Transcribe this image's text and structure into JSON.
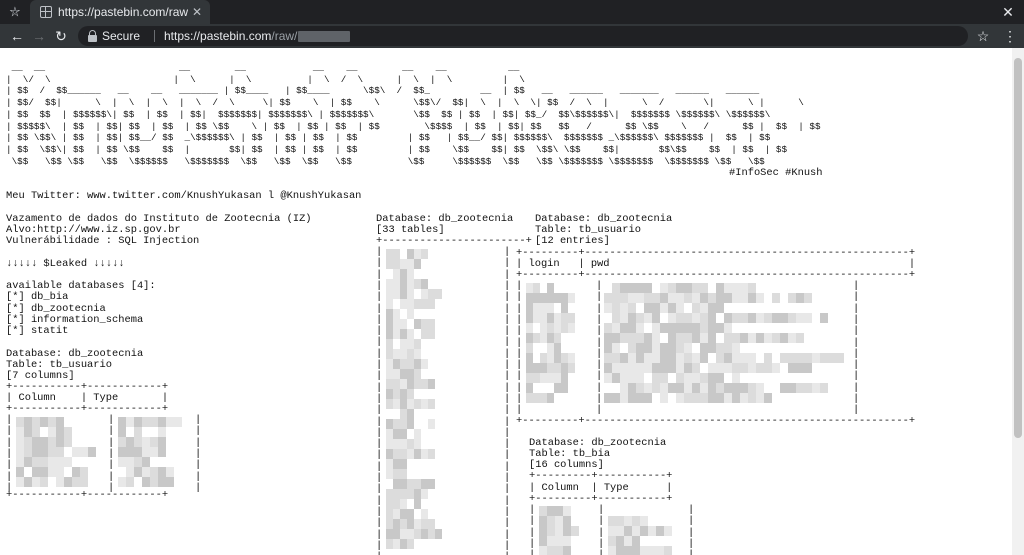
{
  "browser": {
    "tab_title": "https://pastebin.com/raw/",
    "security_label": "Secure",
    "url_domain": "https://pastebin.com",
    "url_path": "/raw/"
  },
  "paste": {
    "banner": [
      " __  __                        __        __            __    __        __    __           __                                      ",
      "|  \\/  \\                      |  \\      |  \\          |  \\  /  \\      |  \\  |  \\         |  \\                                     ",
      "| $$  /  $$______   __    __   _______ | $$____   | $$____      \\$$\\  /  $$_         __  | $$   __   ______   _______   ______   ______  ",
      "| $$/  $$|      \\  |  \\  |  \\  |  \\  /  \\     \\| $$    \\  | $$    \\      \\$$\\/  $$|  \\  |  \\  \\| $$  /  \\  |      \\  /       \\|      \\ |      \\ ",
      "| $$  $$  | $$$$$$\\| $$  | $$  | $$|  $$$$$$$| $$$$$$$\\ | $$$$$$$\\       \\$$  $$ | $$  | $$| $$_/  $$\\$$$$$$\\|  $$$$$$$ \\$$$$$$\\ \\$$$$$$\\",
      "| $$$$$\\  | $$  | $$| $$  | $$  | $$ \\$$    \\ | $$  | $$ | $$  | $$        \\$$$$  | $$  | $$| $$   $$   /      $$ \\$$    \\   /      $$ |  $$  | $$",
      "| $$ \\$$\\ | $$  | $$| $$__/ $$  _\\$$$$$$\\ | $$  | $$ | $$  | $$         | $$   | $$__/ $$| $$$$$$\\  $$$$$$$ _\\$$$$$$\\ $$$$$$$ |  $$  | $$",
      "| $$  \\$$\\| $$  | $$ \\$$    $$  |       $$| $$  | $$ | $$  | $$         | $$    \\$$    $$| $$  \\$$\\ \\$$    $$|       $$\\$$    $$  | $$  | $$",
      " \\$$   \\$$ \\$$   \\$$  \\$$$$$$   \\$$$$$$$  \\$$   \\$$  \\$$   \\$$          \\$$     \\$$$$$$  \\$$   \\$$ \\$$$$$$$ \\$$$$$$$  \\$$$$$$$ \\$$   \\$$"
    ],
    "tags": "#InfoSec #Knush",
    "twitter": "Meu Twitter: www.twitter.com/KnushYukasan l @KnushYukasan",
    "leak_title": "Vazamento de dados do Instituto de Zootecnia (IZ)",
    "alvo": "Alvo:http://www.iz.sp.gov.br",
    "vuln": "Vulnerábilidade : SQL Injection",
    "leaked": "↓↓↓↓↓ $Leaked ↓↓↓↓↓",
    "available": "available databases [4]:",
    "dbs": [
      "[*] db_bia",
      "[*] db_zootecnia",
      "[*] information_schema",
      "[*] statit"
    ],
    "usuario_db": "Database: db_zootecnia",
    "usuario_table": "Table: tb_usuario",
    "usuario_cols": "[7 columns]",
    "col_header": "| Column    | Type       |",
    "border_a": "+-----------+------------+",
    "tables_db": "Database: db_zootecnia",
    "tables_count": "[33 tables]",
    "tables_border": "+-----------------------+",
    "entries_db": "Database: db_zootecnia",
    "entries_table": "Table: tb_usuario",
    "entries_count": "[12 entries]",
    "entries_border": "+---------+----------------------------------------------------+",
    "entries_header": "| login   | pwd                                                |",
    "bia_db": "Database: db_zootecnia",
    "bia_table": "Table: tb_bia",
    "bia_cols": "[16 columns]",
    "bia_border": "+---------+-----------+",
    "bia_header": "| Column  | Type      |"
  },
  "icons": {
    "incognito": "incognito-icon",
    "favicon": "pastebin-favicon-icon",
    "back": "back-arrow-icon",
    "forward": "forward-arrow-icon",
    "reload": "reload-icon",
    "lock": "lock-icon",
    "star": "star-icon",
    "menu": "menu-dots-icon",
    "close": "close-icon"
  }
}
